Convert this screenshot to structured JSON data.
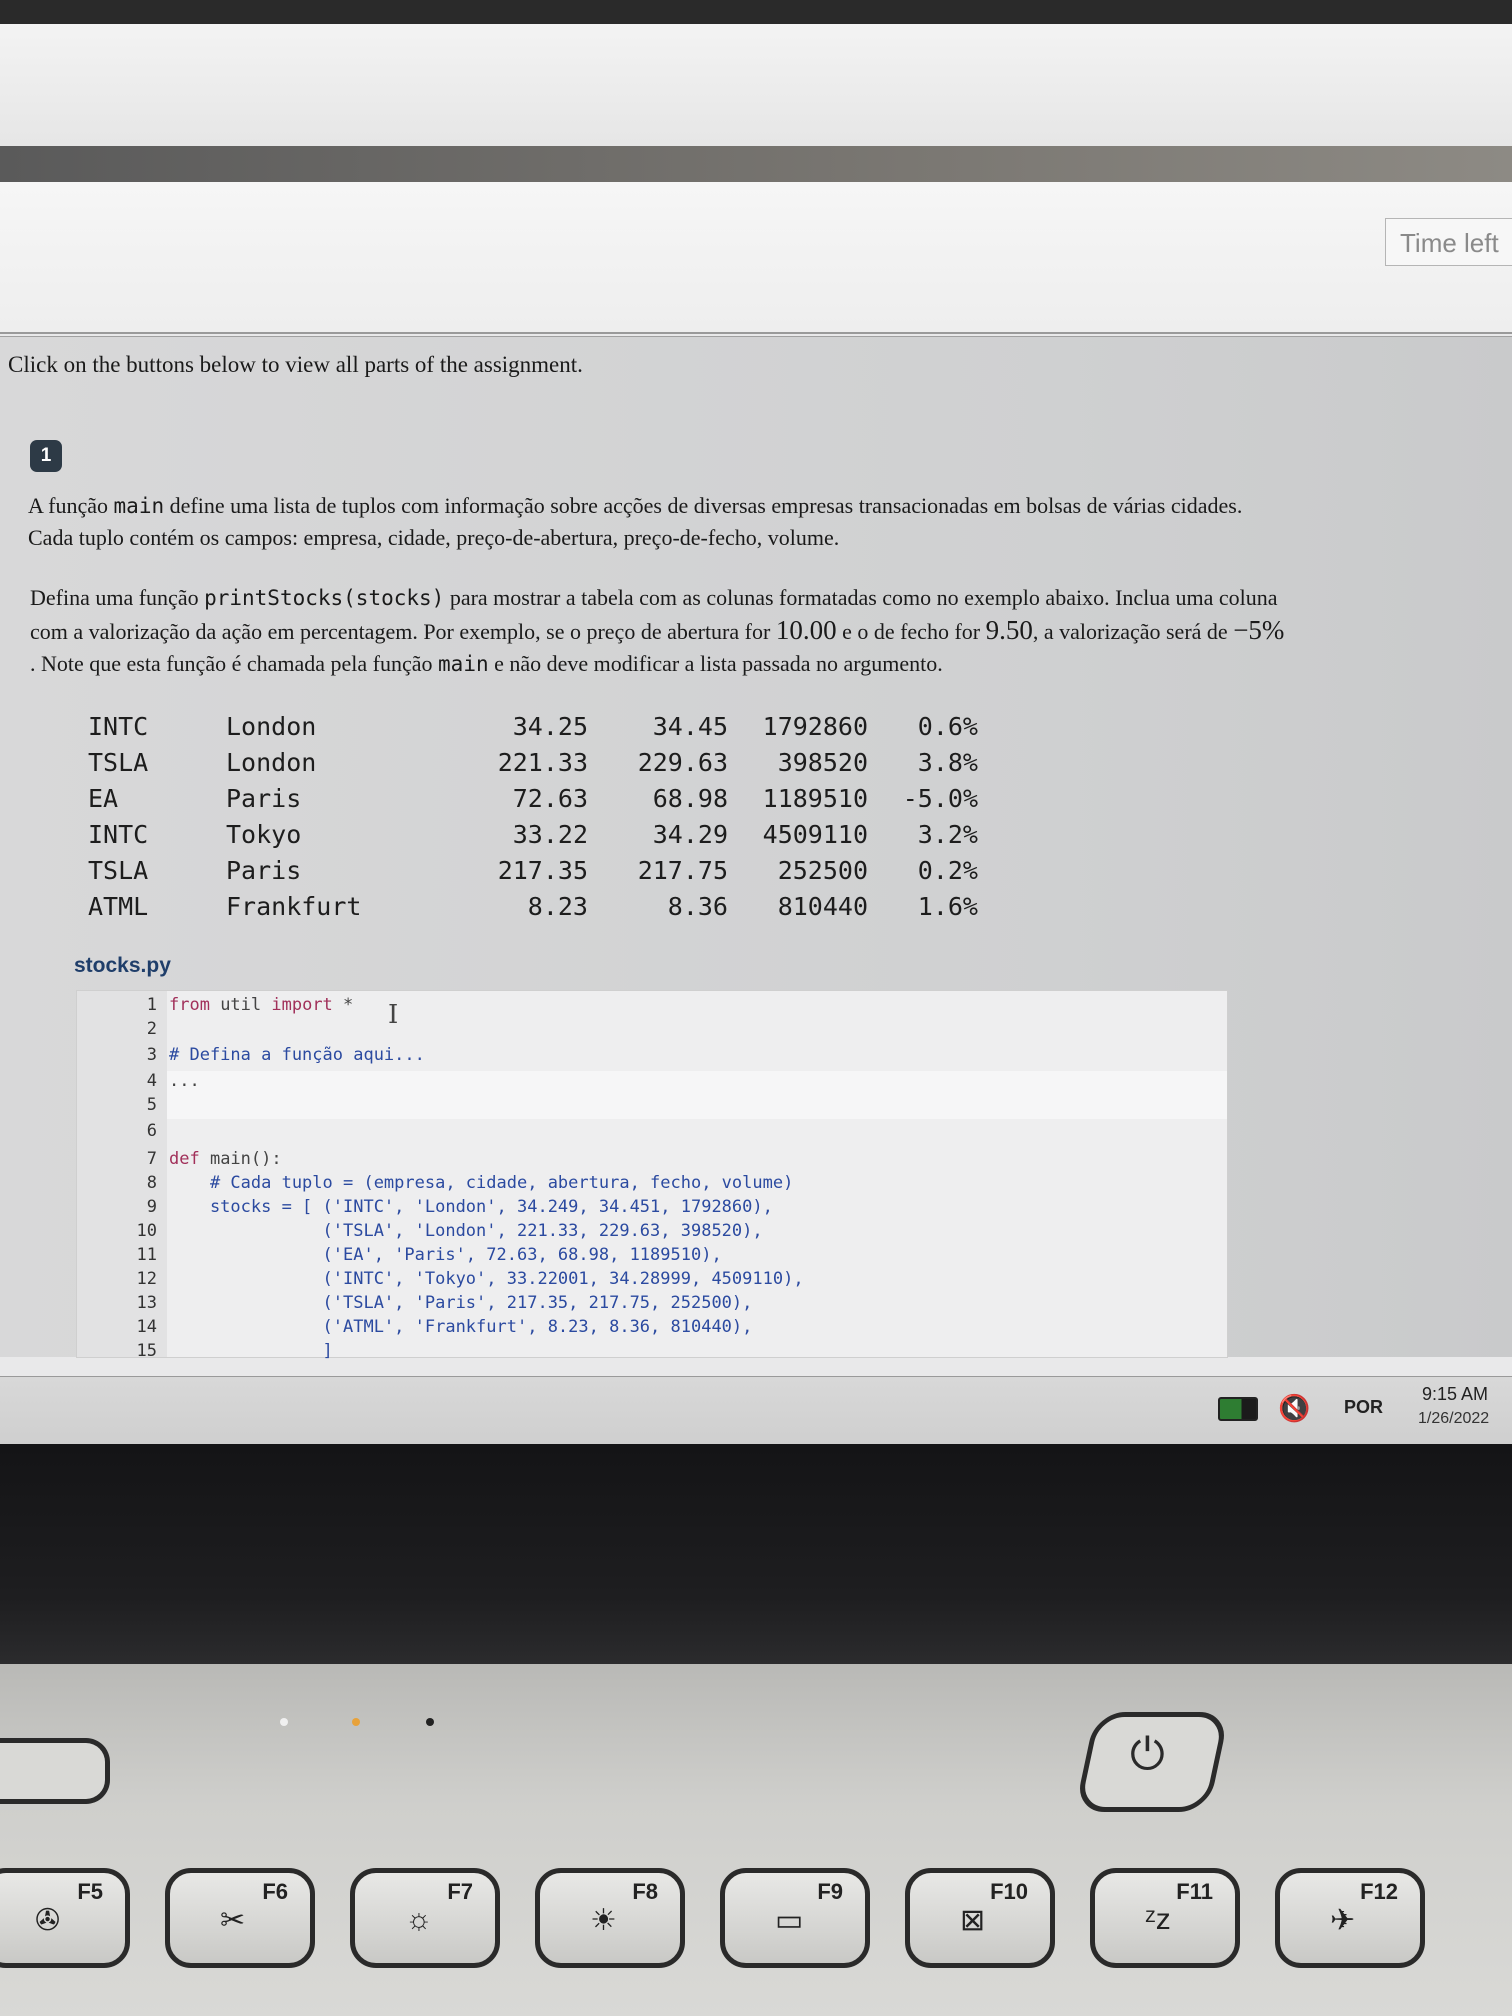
{
  "header": {
    "time_left_label": "Time left"
  },
  "assignment": {
    "intro": "Click on the buttons below to view all parts of the assignment.",
    "part_label": "1",
    "p1": {
      "a": "A função ",
      "code_main": "main",
      "b": " define uma lista de tuplos com informação sobre acções de diversas empresas transacionadas em bolsas de várias cidades.",
      "line2": "Cada tuplo contém os campos: empresa, cidade, preço-de-abertura, preço-de-fecho, volume."
    },
    "p2": {
      "a": "Defina uma função ",
      "code_fn": "printStocks(stocks)",
      "b": " para mostrar a tabela com as colunas formatadas como no exemplo abaixo. Inclua uma coluna",
      "c": "com a valorização da ação em percentagem. Por exemplo, se o preço de abertura for ",
      "v1": "10.00",
      "d": " e o de fecho for ",
      "v2": "9.50",
      "e": ", a valorização será de ",
      "v3": "−5%",
      "f": ". Note que esta função é chamada pela função ",
      "code_main": "main",
      "g": " e não deve modificar a lista passada no argumento."
    }
  },
  "stock_table": [
    [
      "INTC",
      "London",
      "34.25",
      "34.45",
      "1792860",
      "0.6%"
    ],
    [
      "TSLA",
      "London",
      "221.33",
      "229.63",
      "398520",
      "3.8%"
    ],
    [
      "EA",
      "Paris",
      "72.63",
      "68.98",
      "1189510",
      "-5.0%"
    ],
    [
      "INTC",
      "Tokyo",
      "33.22",
      "34.29",
      "4509110",
      "3.2%"
    ],
    [
      "TSLA",
      "Paris",
      "217.35",
      "217.75",
      "252500",
      "0.2%"
    ],
    [
      "ATML",
      "Frankfurt",
      "8.23",
      "8.36",
      "810440",
      "1.6%"
    ]
  ],
  "editor": {
    "filename": "stocks.py",
    "line_numbers": [
      "1",
      "2",
      "3",
      "4",
      "5",
      "6",
      "7",
      "8",
      "9",
      "10",
      "11",
      "12",
      "13",
      "14",
      "15"
    ],
    "lines": {
      "l1_kw1": "from",
      "l1_mid": " util ",
      "l1_kw2": "import",
      "l1_end": " *",
      "l3": "# Defina a função aqui...",
      "l4": "...",
      "l7_kw": "def",
      "l7_rest": " main():",
      "l8": "    # Cada tuplo = (empresa, cidade, abertura, fecho, volume)",
      "l9": "    stocks = [ ('INTC', 'London', 34.249, 34.451, 1792860),",
      "l10": "               ('TSLA', 'London', 221.33, 229.63, 398520),",
      "l11": "               ('EA', 'Paris', 72.63, 68.98, 1189510),",
      "l12": "               ('INTC', 'Tokyo', 33.22001, 34.28999, 4509110),",
      "l13": "               ('TSLA', 'Paris', 217.35, 217.75, 252500),",
      "l14": "               ('ATML', 'Frankfurt', 8.23, 8.36, 810440),",
      "l15": "               ]"
    }
  },
  "taskbar": {
    "language": "POR",
    "time": "9:15 AM",
    "date": "1/26/2022"
  },
  "keyboard": {
    "keys": [
      {
        "label": "F5",
        "icon": "fan-icon"
      },
      {
        "label": "F6",
        "icon": "snip-icon"
      },
      {
        "label": "F7",
        "icon": "brightness-down-icon"
      },
      {
        "label": "F8",
        "icon": "brightness-up-icon"
      },
      {
        "label": "F9",
        "icon": "display-switch-icon"
      },
      {
        "label": "F10",
        "icon": "touchpad-icon"
      },
      {
        "label": "F11",
        "icon": "sleep-icon"
      },
      {
        "label": "F12",
        "icon": "airplane-icon"
      }
    ]
  }
}
